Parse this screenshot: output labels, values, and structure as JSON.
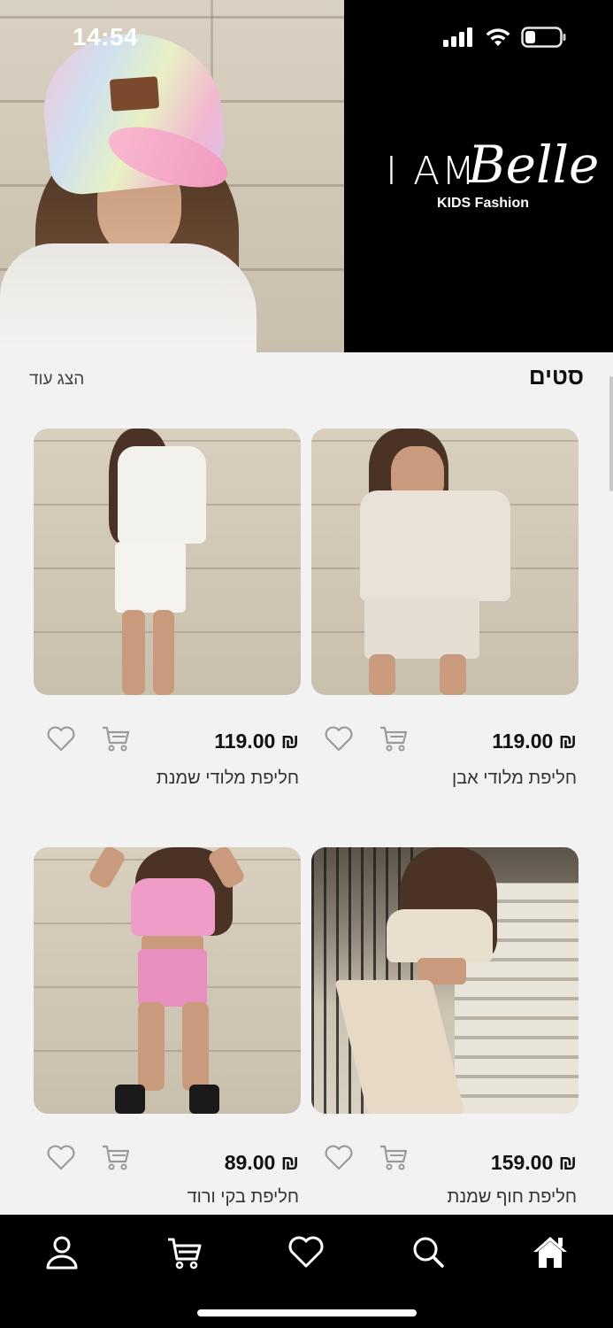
{
  "status_bar": {
    "time": "14:54"
  },
  "brand": {
    "wordmark_left": "I AM",
    "wordmark_script": "Belle",
    "tagline": "KIDS Fashion"
  },
  "section": {
    "title": "סטים",
    "show_more": "הצג עוד"
  },
  "products": [
    {
      "name": "חליפת מלודי אבן",
      "price": "119.00 ₪",
      "top_color": "#e8e2d8",
      "bottom_color": "#e4ddd2"
    },
    {
      "name": "חליפת מלודי שמנת",
      "price": "119.00 ₪",
      "top_color": "#f3f1ec",
      "bottom_color": "#f5f3ef"
    },
    {
      "name": "חליפת חוף שמנת",
      "price": "159.00 ₪",
      "top_color": "#e9dfcf",
      "bottom_color": "#e6dac6"
    },
    {
      "name": "חליפת בקי ורוד",
      "price": "89.00 ₪",
      "top_color": "#ef9cc8",
      "bottom_color": "#e98fc0"
    }
  ],
  "bottom_nav": [
    {
      "icon": "profile-icon"
    },
    {
      "icon": "cart-icon"
    },
    {
      "icon": "heart-icon"
    },
    {
      "icon": "search-icon"
    },
    {
      "icon": "home-icon"
    }
  ],
  "colors": {
    "background": "#f2f2f2",
    "nav_background": "#000000",
    "text": "#111111"
  }
}
